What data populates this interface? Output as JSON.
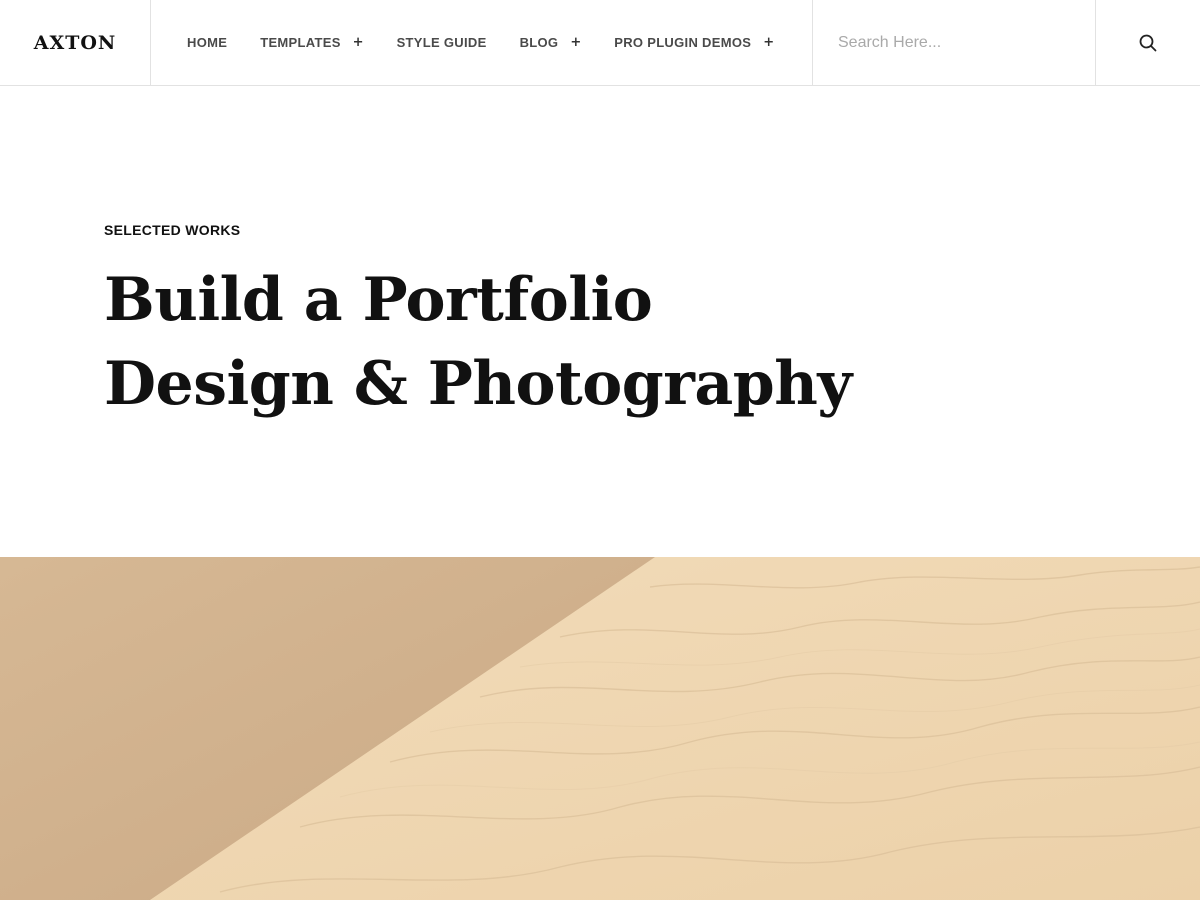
{
  "brand": {
    "logo_text": "AXTON"
  },
  "nav": {
    "items": [
      {
        "label": "HOME",
        "has_submenu": false
      },
      {
        "label": "TEMPLATES",
        "has_submenu": true
      },
      {
        "label": "STYLE GUIDE",
        "has_submenu": false
      },
      {
        "label": "BLOG",
        "has_submenu": true
      },
      {
        "label": "PRO PLUGIN DEMOS",
        "has_submenu": true
      }
    ],
    "submenu_glyph": "+"
  },
  "search": {
    "placeholder": "Search Here...",
    "value": "",
    "icon": "search-icon"
  },
  "hero": {
    "eyebrow": "SELECTED WORKS",
    "headline_line1": "Build a Portfolio",
    "headline_line2": "Design & Photography",
    "image": "sand-dune-photo"
  },
  "colors": {
    "text": "#111111",
    "nav_text": "#4a4a4a",
    "divider": "#e2e2e2",
    "sand_light": "#f0d7b2",
    "sand_shadow": "#d2b28e"
  }
}
